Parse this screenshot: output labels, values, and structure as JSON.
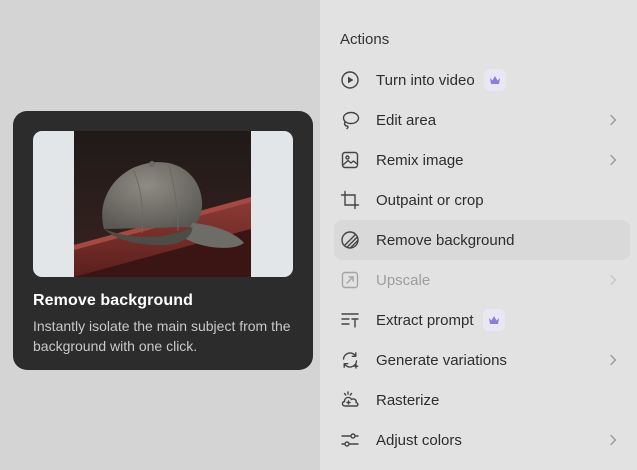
{
  "preview": {
    "title": "Remove background",
    "description": "Instantly isolate the main subject from the background with one click."
  },
  "actions": {
    "heading": "Actions",
    "items": [
      {
        "label": "Turn into video",
        "icon": "play-circle-icon",
        "premium": true,
        "chevron": false,
        "disabled": false,
        "active": false
      },
      {
        "label": "Edit area",
        "icon": "lasso-icon",
        "premium": false,
        "chevron": true,
        "disabled": false,
        "active": false
      },
      {
        "label": "Remix image",
        "icon": "image-icon",
        "premium": false,
        "chevron": true,
        "disabled": false,
        "active": false
      },
      {
        "label": "Outpaint or crop",
        "icon": "crop-icon",
        "premium": false,
        "chevron": false,
        "disabled": false,
        "active": false
      },
      {
        "label": "Remove background",
        "icon": "remove-background-icon",
        "premium": false,
        "chevron": false,
        "disabled": false,
        "active": true
      },
      {
        "label": "Upscale",
        "icon": "upscale-icon",
        "premium": false,
        "chevron": true,
        "disabled": true,
        "active": false
      },
      {
        "label": "Extract prompt",
        "icon": "extract-text-icon",
        "premium": true,
        "chevron": false,
        "disabled": false,
        "active": false
      },
      {
        "label": "Generate variations",
        "icon": "refresh-sparkle-icon",
        "premium": false,
        "chevron": true,
        "disabled": false,
        "active": false
      },
      {
        "label": "Rasterize",
        "icon": "cloud-grid-icon",
        "premium": false,
        "chevron": false,
        "disabled": false,
        "active": false
      },
      {
        "label": "Adjust colors",
        "icon": "sliders-icon",
        "premium": false,
        "chevron": true,
        "disabled": false,
        "active": false
      }
    ]
  },
  "colors": {
    "premium_accent": "#8a7fd6",
    "card_background": "#2c2c2c",
    "active_row": "#d9d9d9"
  }
}
